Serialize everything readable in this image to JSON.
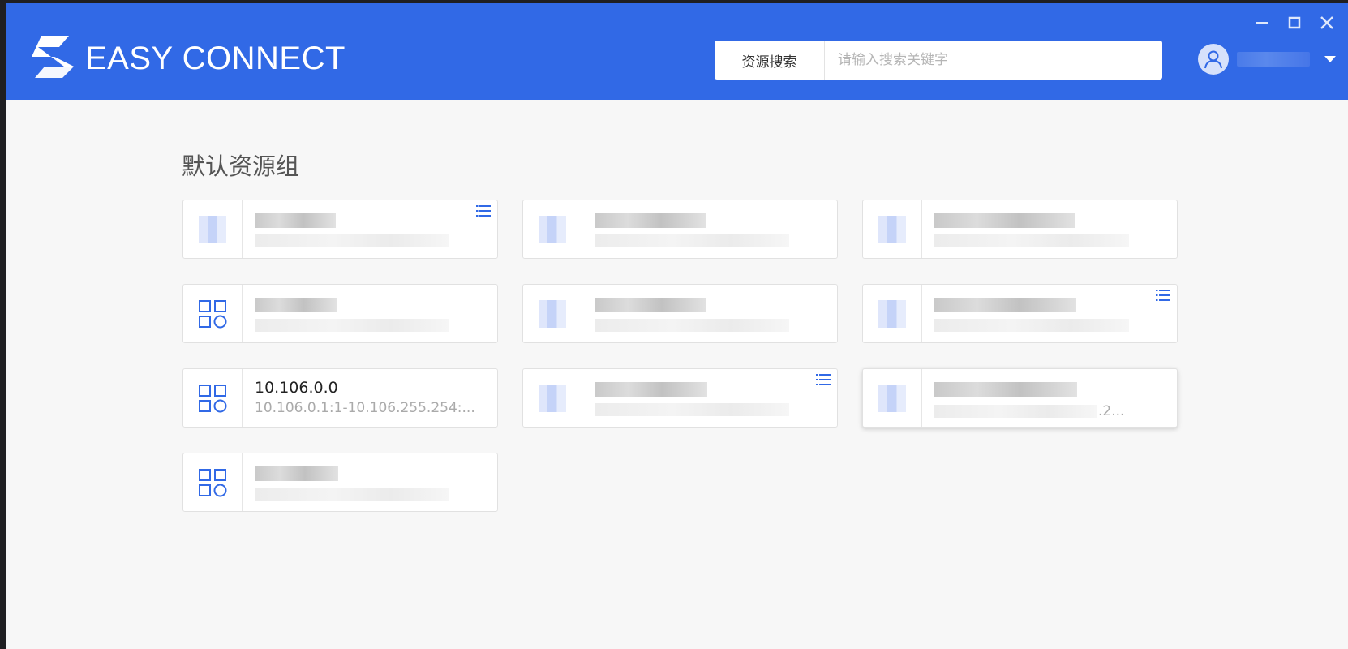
{
  "app": {
    "brand_text": "EASY CONNECT",
    "accent_color": "#3169e6"
  },
  "search": {
    "category_label": "资源搜索",
    "placeholder": "请输入搜索关键字",
    "value": ""
  },
  "window_controls": [
    "minimize-icon",
    "maximize-icon",
    "close-icon"
  ],
  "group": {
    "title": "默认资源组"
  },
  "resources": [
    {
      "name": "",
      "address": "",
      "obscured": true,
      "has_list_icon": true
    },
    {
      "name": "",
      "address": "",
      "obscured": true,
      "has_list_icon": false
    },
    {
      "name": "",
      "address": "",
      "obscured": true,
      "has_list_icon": false
    },
    {
      "name": "",
      "address": "",
      "obscured": true,
      "has_list_icon": false
    },
    {
      "name": "",
      "address": "",
      "obscured": true,
      "has_list_icon": false
    },
    {
      "name": "",
      "address": "",
      "obscured": true,
      "has_list_icon": true
    },
    {
      "name": "10.106.0.0",
      "address": "10.106.0.1:1-10.106.255.254:...",
      "obscured": false,
      "has_list_icon": false
    },
    {
      "name": "",
      "address": "",
      "obscured": true,
      "has_list_icon": true
    },
    {
      "name": "",
      "address": ".2...",
      "obscured": true,
      "has_list_icon": false
    },
    {
      "name": "",
      "address": "",
      "obscured": true,
      "has_list_icon": false
    }
  ]
}
